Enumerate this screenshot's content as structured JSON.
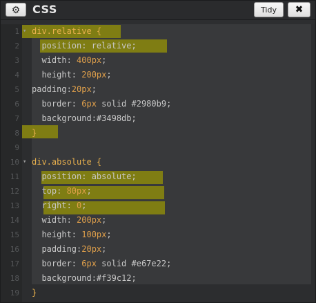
{
  "header": {
    "title": "CSS",
    "tidy_label": "Tidy",
    "close_label": "✖",
    "gear_icon": "⚙"
  },
  "lines": [
    {
      "n": "1",
      "text": "div.relative {"
    },
    {
      "n": "2",
      "text": "  position: relative;"
    },
    {
      "n": "3",
      "text": "  width: 400px;"
    },
    {
      "n": "4",
      "text": "  height: 200px;"
    },
    {
      "n": "5",
      "text": "padding:20px;"
    },
    {
      "n": "6",
      "text": "  border: 6px solid #2980b9;"
    },
    {
      "n": "7",
      "text": "  background:#3498db;"
    },
    {
      "n": "8",
      "text": "}"
    },
    {
      "n": "9",
      "text": ""
    },
    {
      "n": "10",
      "text": "div.absolute {"
    },
    {
      "n": "11",
      "text": "  position: absolute;"
    },
    {
      "n": "12",
      "text": "  top: 80px;"
    },
    {
      "n": "13",
      "text": "  right: 0;"
    },
    {
      "n": "14",
      "text": "  width: 200px;"
    },
    {
      "n": "15",
      "text": "  height: 100px;"
    },
    {
      "n": "16",
      "text": "  padding:20px;"
    },
    {
      "n": "17",
      "text": "  border: 6px solid #e67e22;"
    },
    {
      "n": "18",
      "text": "  background:#f39c12;"
    },
    {
      "n": "19",
      "text": "}"
    }
  ],
  "colors": {
    "highlight": "#7f7d13",
    "selector": "#e8b04d",
    "number": "#e0a04b"
  }
}
